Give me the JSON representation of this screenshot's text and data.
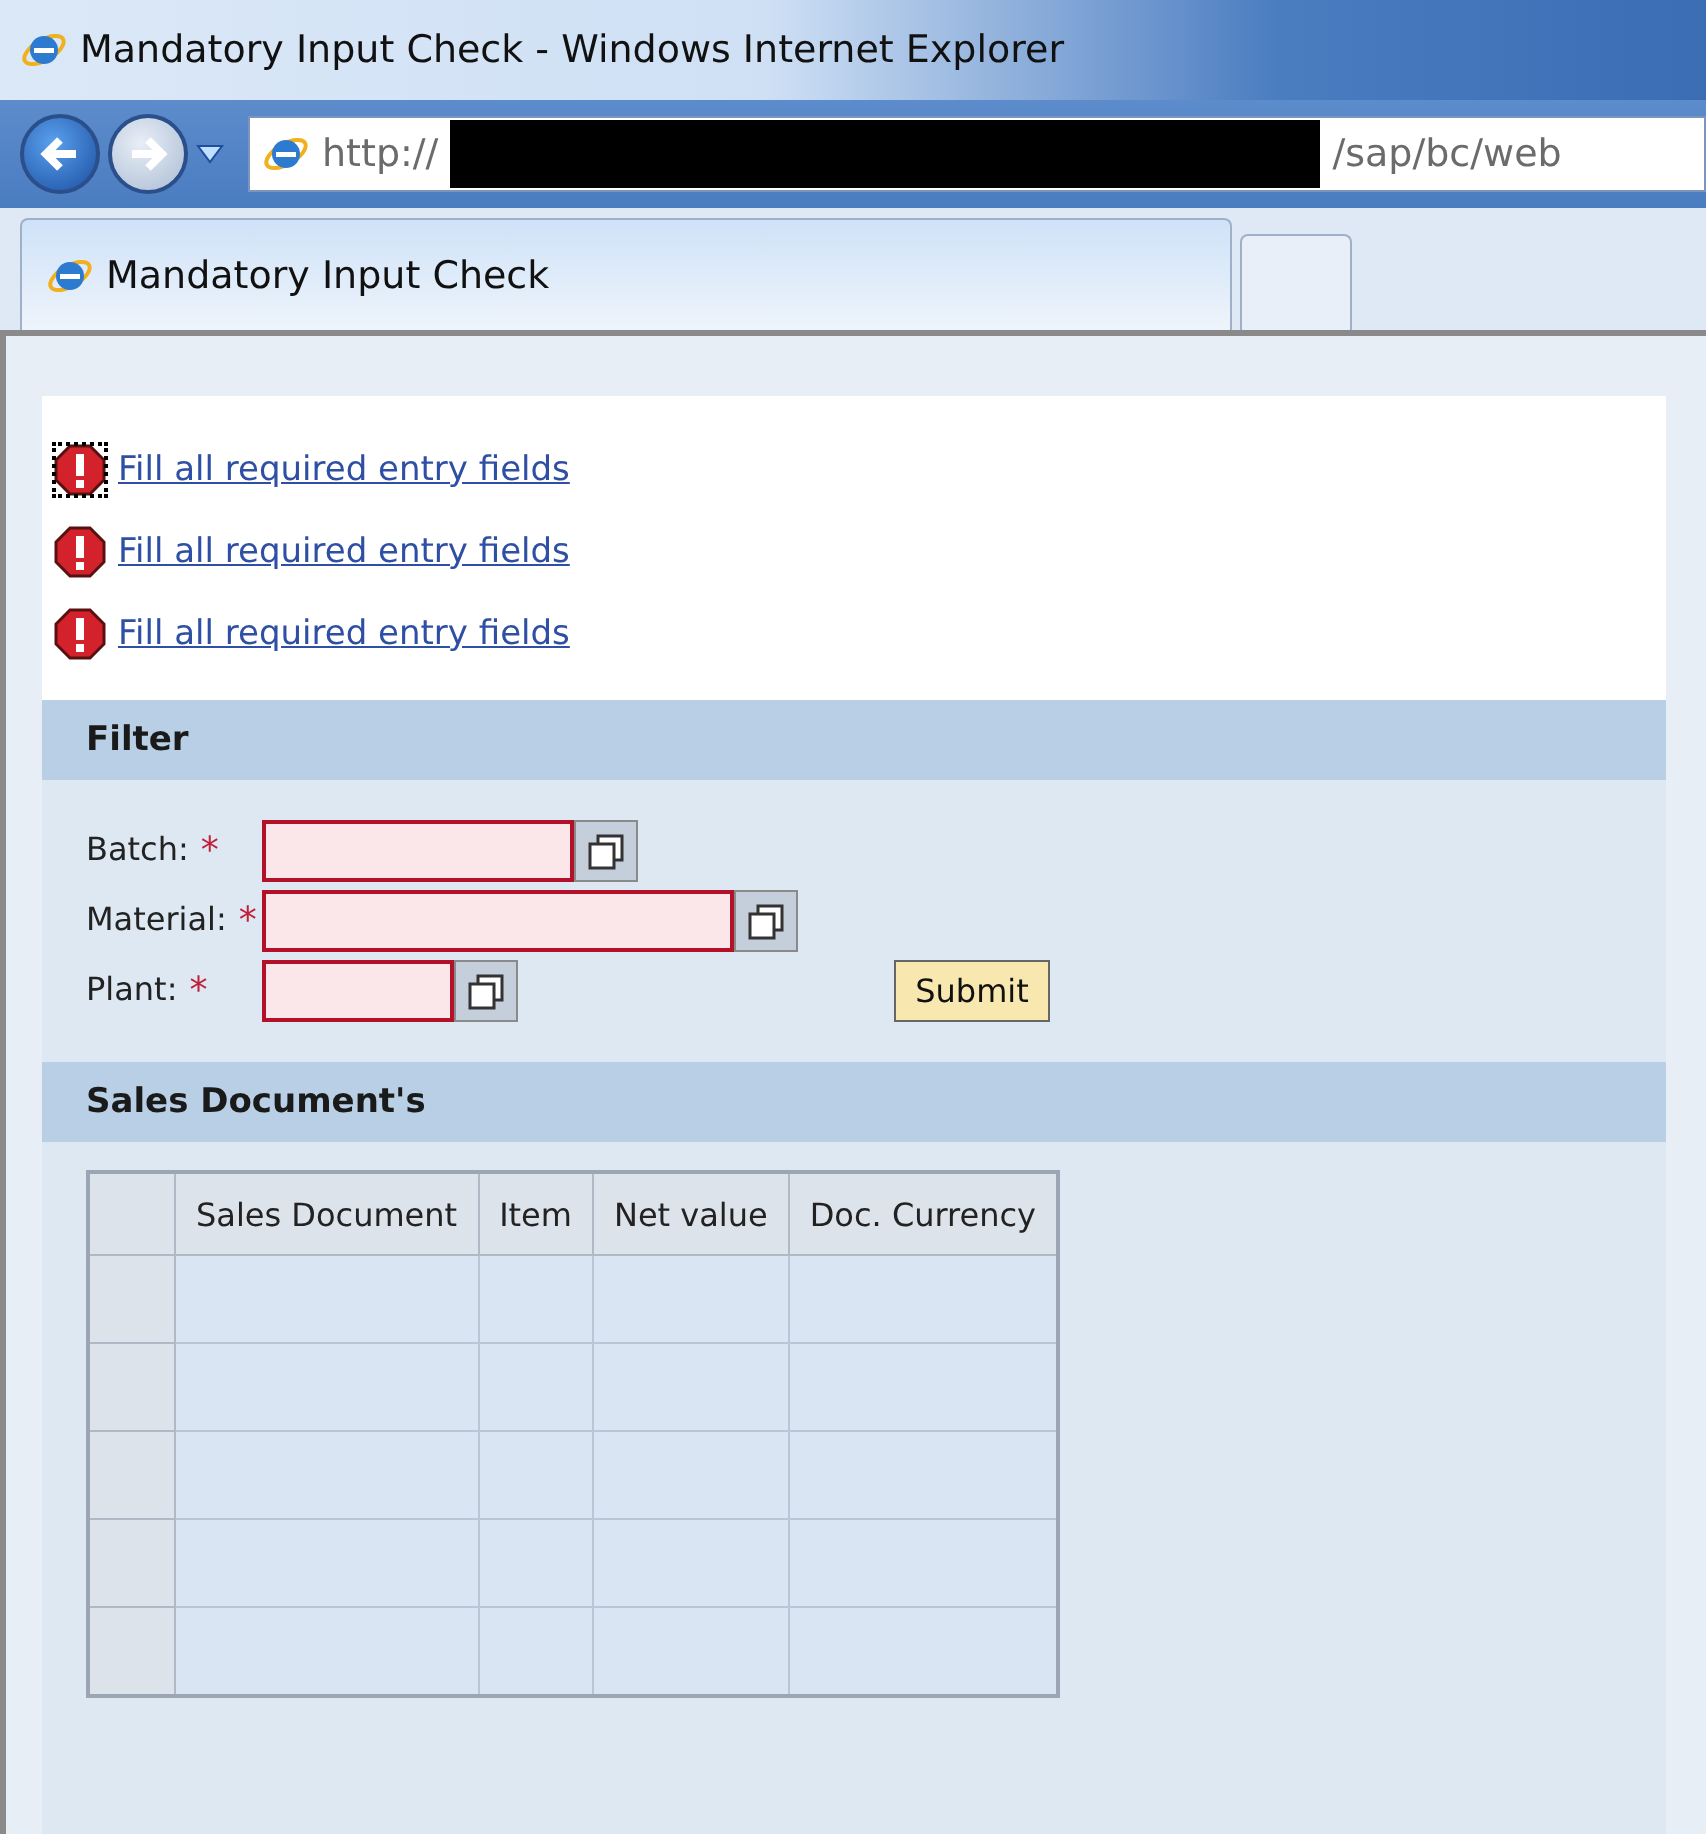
{
  "window": {
    "title": "Mandatory Input Check - Windows Internet Explorer"
  },
  "address_bar": {
    "prefix": "http://",
    "suffix": "/sap/bc/web",
    "redacted": true
  },
  "tabs": [
    {
      "label": "Mandatory Input Check",
      "selected": true
    },
    {
      "selected": false
    }
  ],
  "messages": [
    {
      "text": "Fill all required entry fields",
      "focused": true
    },
    {
      "text": "Fill all required entry fields",
      "focused": false
    },
    {
      "text": "Fill all required entry fields",
      "focused": false
    }
  ],
  "filter": {
    "title": "Filter",
    "fields": [
      {
        "label": "Batch:",
        "required_mark": "*",
        "error": true
      },
      {
        "label": "Material:",
        "required_mark": "*",
        "error": true
      },
      {
        "label": "Plant:",
        "required_mark": "*",
        "error": true
      }
    ],
    "submit": "Submit"
  },
  "table_section": {
    "title": "Sales Document's",
    "columns": [
      "Sales Document",
      "Item",
      "Net value",
      "Doc. Currency"
    ],
    "rows": [
      {
        "selected": false
      },
      {
        "selected": false
      },
      {
        "selected": false
      },
      {
        "selected": false
      },
      {
        "selected": false
      }
    ]
  }
}
